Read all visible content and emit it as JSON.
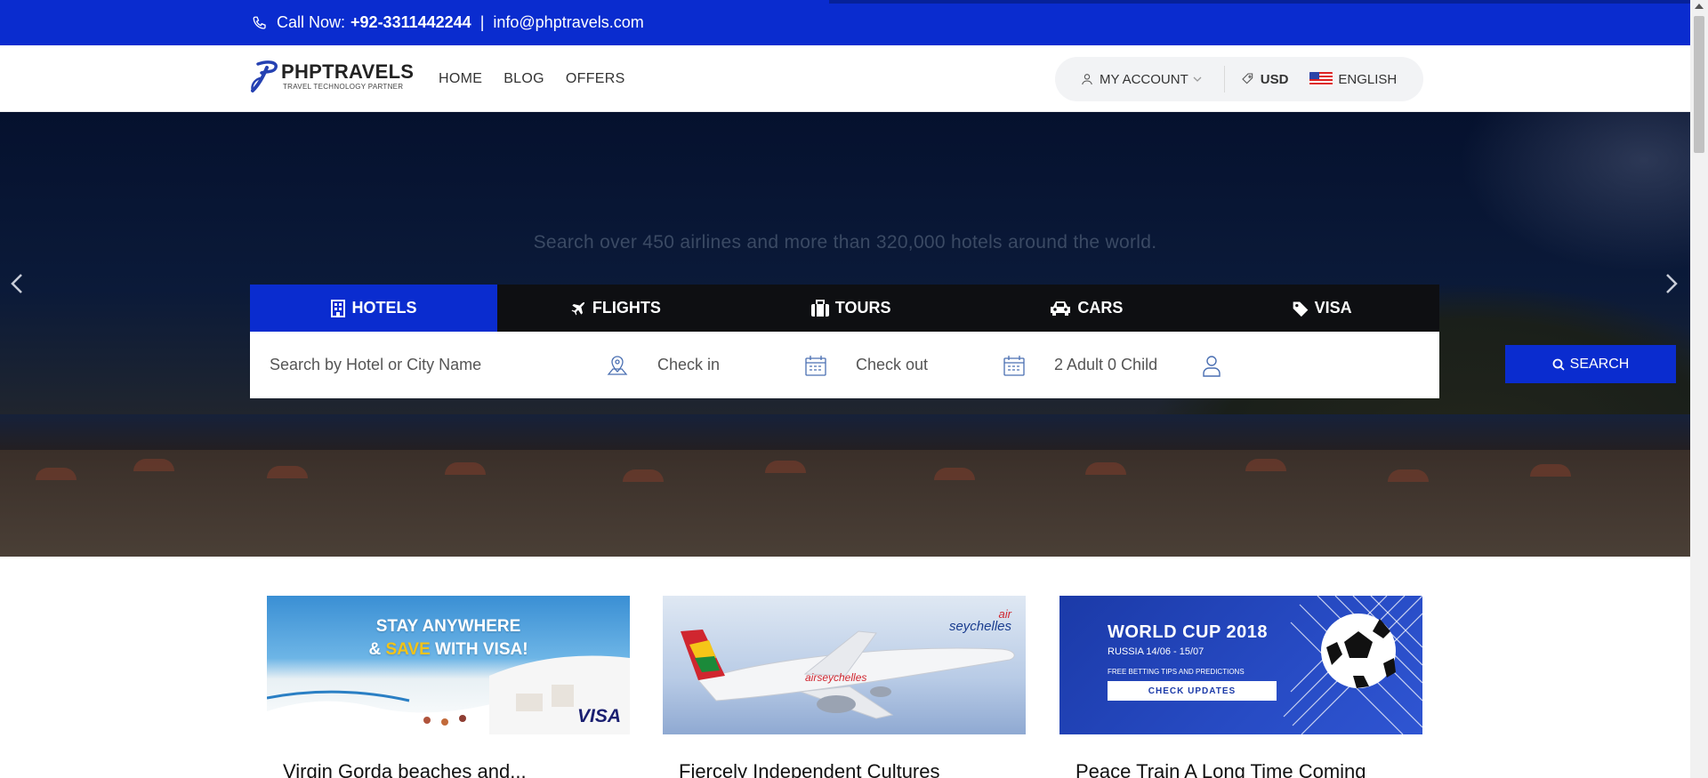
{
  "topbar": {
    "call_label": "Call Now:",
    "phone": "+92-3311442244",
    "separator": "|",
    "email": "info@phptravels.com",
    "icon": "phone-icon"
  },
  "brand": {
    "name": "PHPTRAVELS",
    "tagline": "TRAVEL TECHNOLOGY PARTNER"
  },
  "nav": {
    "items": [
      "HOME",
      "BLOG",
      "OFFERS"
    ]
  },
  "account": {
    "my_account": "MY ACCOUNT",
    "currency": "USD",
    "language": "ENGLISH"
  },
  "hero": {
    "subtitle": "Search over 450 airlines and more than 320,000 hotels around the world."
  },
  "search": {
    "tabs": [
      {
        "label": "HOTELS",
        "icon": "building-icon",
        "active": true
      },
      {
        "label": "FLIGHTS",
        "icon": "plane-icon",
        "active": false
      },
      {
        "label": "TOURS",
        "icon": "suitcase-icon",
        "active": false
      },
      {
        "label": "CARS",
        "icon": "car-icon",
        "active": false
      },
      {
        "label": "VISA",
        "icon": "tag-icon",
        "active": false
      }
    ],
    "destination_placeholder": "Search by Hotel or City Name",
    "checkin_placeholder": "Check in",
    "checkout_placeholder": "Check out",
    "guests": "2 Adult 0 Child",
    "button_label": "SEARCH"
  },
  "cards": [
    {
      "title": "Virgin Gorda beaches and...",
      "image": {
        "line1": "STAY ANYWHERE",
        "line2_a": "& ",
        "line2_b": "SAVE",
        "line2_c": " WITH VISA!",
        "brand": "VISA"
      }
    },
    {
      "title": "Fiercely Independent Cultures",
      "image": {
        "brand_a": "air",
        "brand_b": "seychelles"
      }
    },
    {
      "title": "Peace Train A Long Time Coming",
      "image": {
        "line1": "WORLD CUP 2018",
        "line2": "RUSSIA 14/06 - 15/07",
        "line3": "FREE BETTING TIPS AND PREDICTIONS",
        "cta": "CHECK UPDATES"
      }
    }
  ],
  "colors": {
    "primary": "#0a2ccf",
    "tab_bar": "#0e0f12"
  }
}
